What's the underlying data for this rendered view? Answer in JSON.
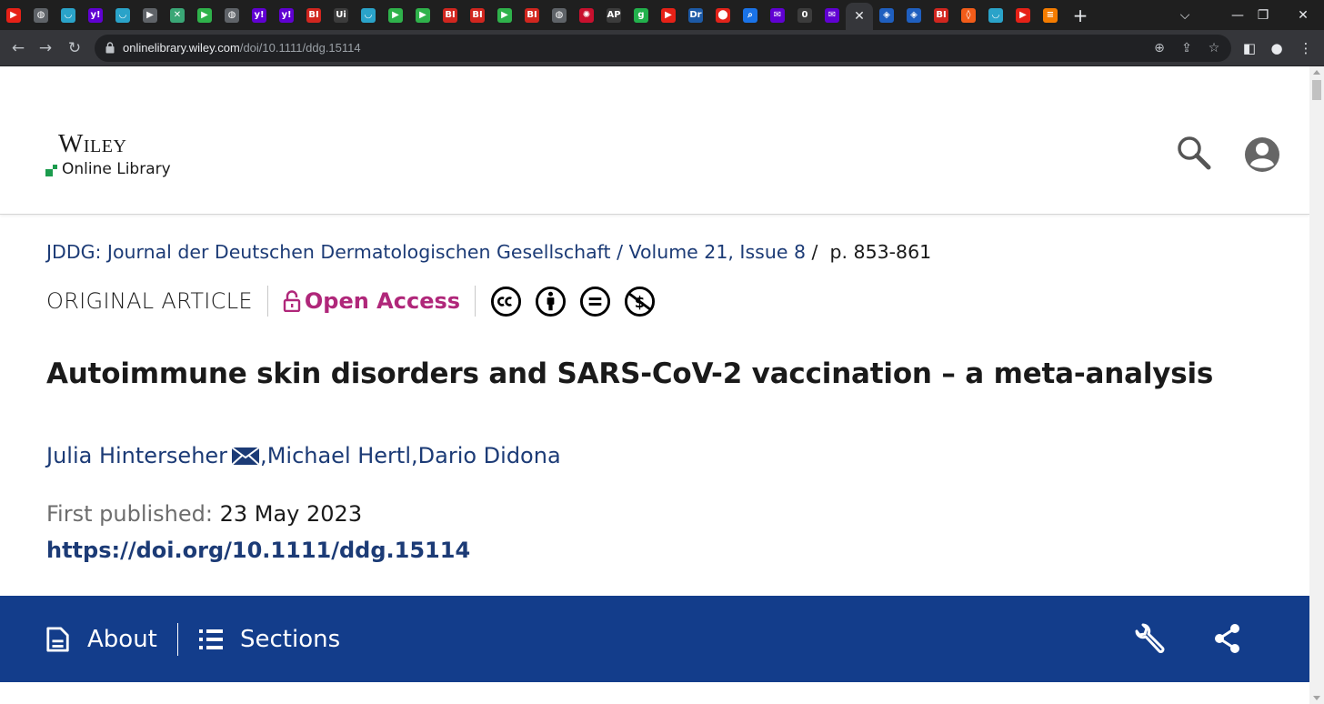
{
  "browser": {
    "tabs": [
      {
        "icon": "youtube-icon",
        "glyph": "▶",
        "color": "#e62117"
      },
      {
        "icon": "globe-icon",
        "glyph": "◍",
        "color": "#5f6368"
      },
      {
        "icon": "shield-icon",
        "glyph": "◡",
        "color": "#2aa3c9"
      },
      {
        "icon": "yahoo-icon",
        "glyph": "y!",
        "color": "#6001d2"
      },
      {
        "icon": "shield-icon",
        "glyph": "◡",
        "color": "#2aa3c9"
      },
      {
        "icon": "arrow-icon",
        "glyph": "▶",
        "color": "#5f6368"
      },
      {
        "icon": "sheet-icon",
        "glyph": "✕",
        "color": "#3aa776"
      },
      {
        "icon": "play-icon",
        "glyph": "▶",
        "color": "#2fb24b"
      },
      {
        "icon": "globe-icon",
        "glyph": "◍",
        "color": "#5f6368"
      },
      {
        "icon": "yahoo-icon",
        "glyph": "y!",
        "color": "#6001d2"
      },
      {
        "icon": "yahoo-icon",
        "glyph": "y!",
        "color": "#6001d2"
      },
      {
        "icon": "bi-icon",
        "glyph": "BI",
        "color": "#d1261f"
      },
      {
        "icon": "text-icon",
        "glyph": "Ui",
        "color": "#3c3c3c"
      },
      {
        "icon": "shield-icon",
        "glyph": "◡",
        "color": "#2aa3c9"
      },
      {
        "icon": "play-icon",
        "glyph": "▶",
        "color": "#2fb24b"
      },
      {
        "icon": "play-icon",
        "glyph": "▶",
        "color": "#2fb24b"
      },
      {
        "icon": "bi-icon",
        "glyph": "BI",
        "color": "#d1261f"
      },
      {
        "icon": "bi-icon",
        "glyph": "BI",
        "color": "#d1261f"
      },
      {
        "icon": "play-icon",
        "glyph": "▶",
        "color": "#2fb24b"
      },
      {
        "icon": "bi-icon",
        "glyph": "BI",
        "color": "#d1261f"
      },
      {
        "icon": "globe-icon",
        "glyph": "◍",
        "color": "#5f6368"
      },
      {
        "icon": "burst-icon",
        "glyph": "✺",
        "color": "#c8102e"
      },
      {
        "icon": "news-icon",
        "glyph": "AP",
        "color": "#3c3c3c"
      },
      {
        "icon": "g-icon",
        "glyph": "g",
        "color": "#22b14c"
      },
      {
        "icon": "youtube-icon",
        "glyph": "▶",
        "color": "#e62117"
      },
      {
        "icon": "dr-icon",
        "glyph": "Dr",
        "color": "#1d5aa6"
      },
      {
        "icon": "pin-icon",
        "glyph": "⬤",
        "color": "#e2231a"
      },
      {
        "icon": "search-icon",
        "glyph": "⌕",
        "color": "#1a73e8"
      },
      {
        "icon": "mail-icon",
        "glyph": "✉",
        "color": "#6001d2"
      },
      {
        "icon": "circle-icon",
        "glyph": "0",
        "color": "#3c3c3c"
      },
      {
        "icon": "mail-icon",
        "glyph": "✉",
        "color": "#6001d2"
      }
    ],
    "tabs_after": [
      {
        "icon": "cube-icon",
        "glyph": "◈",
        "color": "#1f5fbf"
      },
      {
        "icon": "cube-icon",
        "glyph": "◈",
        "color": "#1f5fbf"
      },
      {
        "icon": "bi-icon",
        "glyph": "BI",
        "color": "#d1261f"
      },
      {
        "icon": "brave-icon",
        "glyph": "◊",
        "color": "#f25c19"
      },
      {
        "icon": "shield-icon",
        "glyph": "◡",
        "color": "#2aa3c9"
      },
      {
        "icon": "youtube-icon",
        "glyph": "▶",
        "color": "#e62117"
      },
      {
        "icon": "bookmark-icon",
        "glyph": "≡",
        "color": "#f57c00"
      }
    ],
    "url_host": "onlinelibrary.wiley.com",
    "url_path": "/doi/10.1111/ddg.15114"
  },
  "header": {
    "logo_top": "Wiley",
    "logo_bottom": "Online Library"
  },
  "article": {
    "journal": "JDDG: Journal der Deutschen Dermatologischen Gesellschaft",
    "volume_issue": "Volume 21, Issue 8",
    "pages": "p. 853-861",
    "type": "ORIGINAL ARTICLE",
    "access": "Open Access",
    "title": "Autoimmune skin disorders and SARS-CoV-2 vaccination – a meta-analysis",
    "authors": [
      "Julia Hinterseher",
      "Michael Hertl",
      "Dario Didona"
    ],
    "published_label": "First published:",
    "published_date": "23 May 2023",
    "doi": "https://doi.org/10.1111/ddg.15114"
  },
  "nav": {
    "about": "About",
    "sections": "Sections"
  },
  "colors": {
    "brand_blue": "#133d8b",
    "link_blue": "#1c3b76",
    "open_access": "#b0277a",
    "logo_green": "#1b9c4d"
  }
}
